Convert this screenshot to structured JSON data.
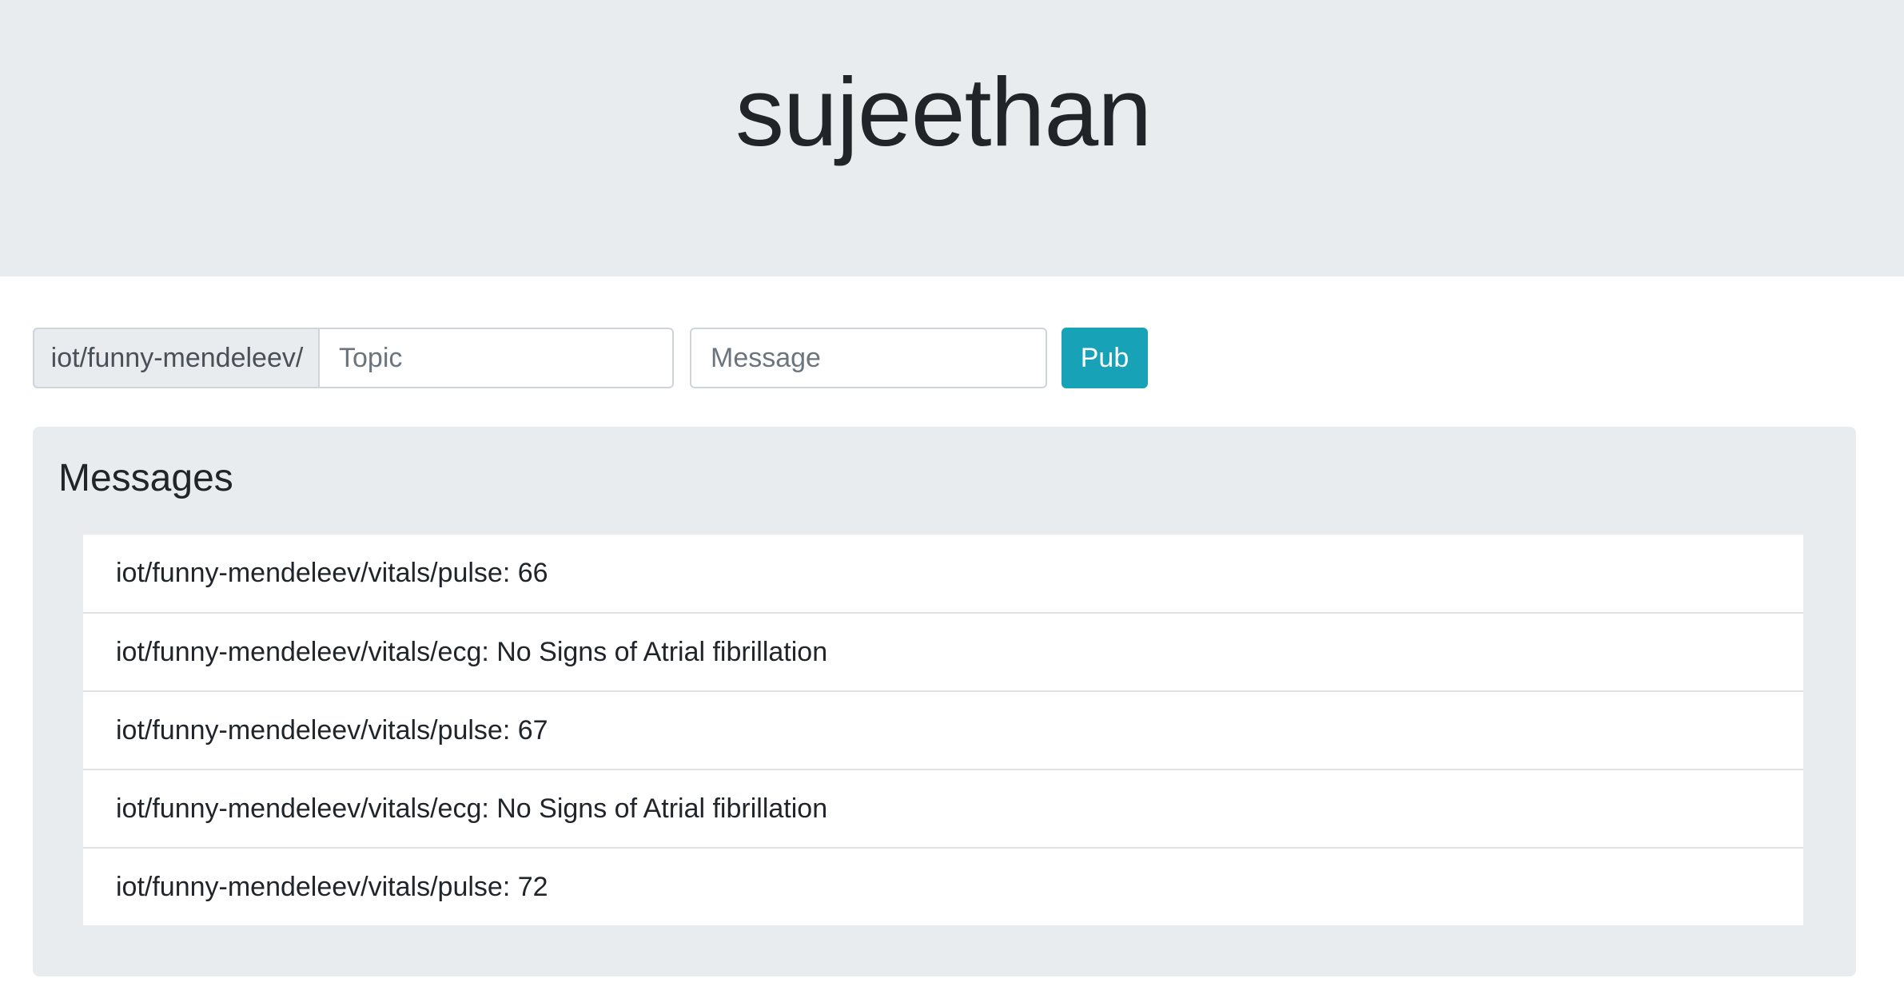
{
  "header": {
    "title": "sujeethan"
  },
  "publish": {
    "topic_prefix": "iot/funny-mendeleev/",
    "topic_placeholder": "Topic",
    "message_placeholder": "Message",
    "button_label": "Pub",
    "button_color": "#17a2b8"
  },
  "messages": {
    "heading": "Messages",
    "items": [
      "iot/funny-mendeleev/vitals/pulse: 66",
      "iot/funny-mendeleev/vitals/ecg: No Signs of Atrial fibrillation",
      "iot/funny-mendeleev/vitals/pulse: 67",
      "iot/funny-mendeleev/vitals/ecg: No Signs of Atrial fibrillation",
      "iot/funny-mendeleev/vitals/pulse: 72"
    ]
  },
  "colors": {
    "jumbotron_bg": "#e9ecef",
    "text": "#212529"
  }
}
